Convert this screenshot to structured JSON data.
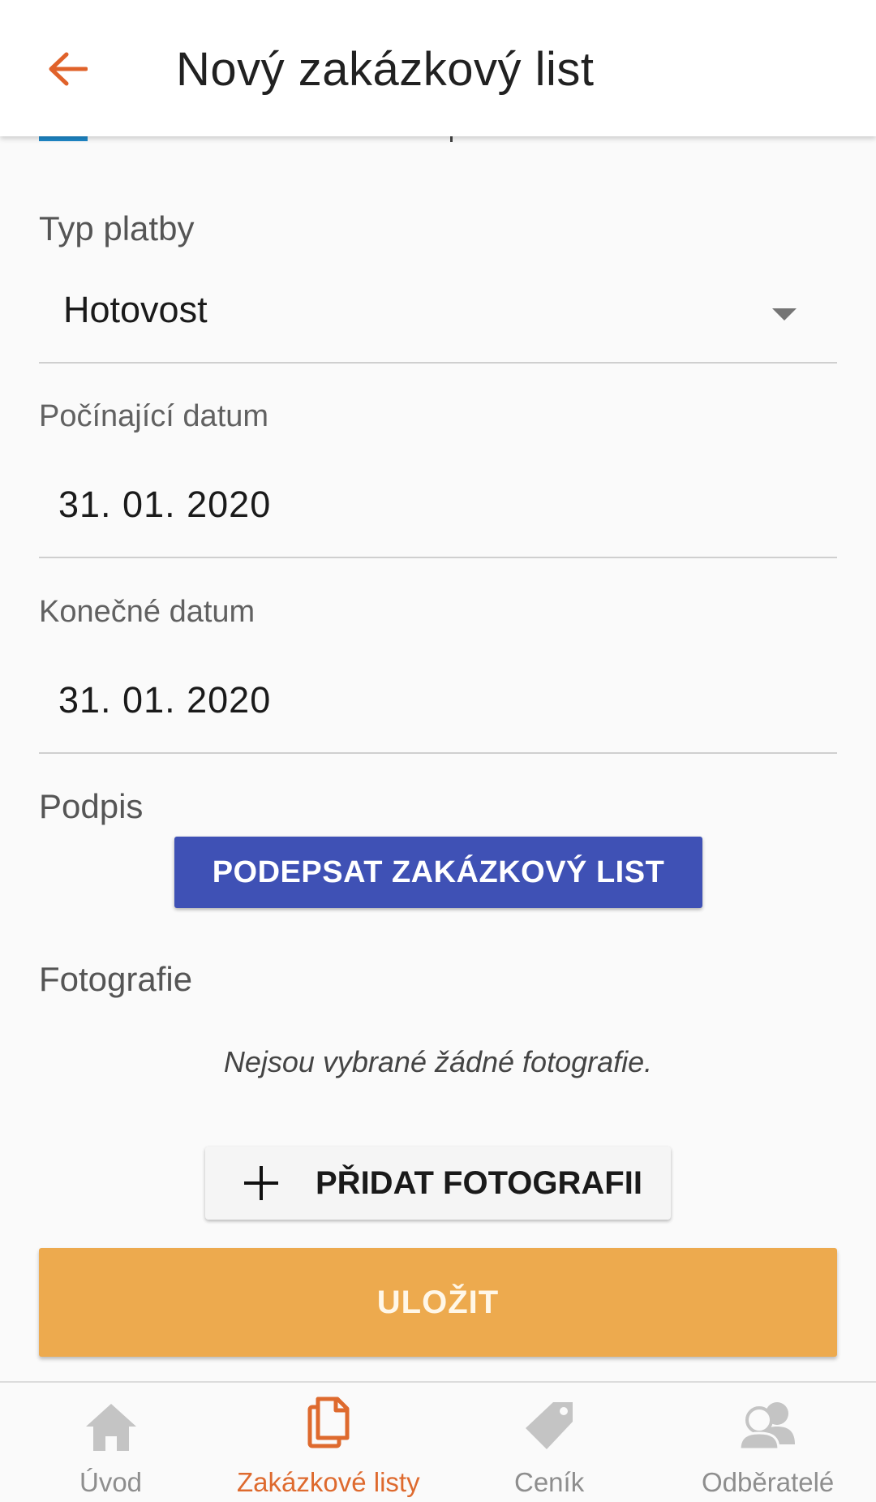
{
  "header": {
    "title": "Nový zakázkový list",
    "accent_color": "#e0622a"
  },
  "form": {
    "payment": {
      "label": "Typ platby",
      "value": "Hotovost"
    },
    "start_date": {
      "label": "Počínající datum",
      "value": "31. 01. 2020"
    },
    "end_date": {
      "label": "Konečné datum",
      "value": "31. 01. 2020"
    },
    "signature": {
      "label": "Podpis",
      "button_label": "PODEPSAT ZAKÁZKOVÝ LIST",
      "button_color": "#3f51b5"
    },
    "photos": {
      "label": "Fotografie",
      "empty_text": "Nejsou vybrané žádné fotografie.",
      "add_button_label": "PŘIDAT FOTOGRAFII"
    },
    "save_label": "ULOŽIT",
    "save_color": "#edaa4e"
  },
  "bottom_nav": {
    "items": [
      {
        "label": "Úvod",
        "icon": "home-icon",
        "active": false
      },
      {
        "label": "Zakázkové listy",
        "icon": "documents-icon",
        "active": true
      },
      {
        "label": "Ceník",
        "icon": "price-tag-icon",
        "active": false
      },
      {
        "label": "Odběratelé",
        "icon": "customers-icon",
        "active": false
      }
    ]
  }
}
